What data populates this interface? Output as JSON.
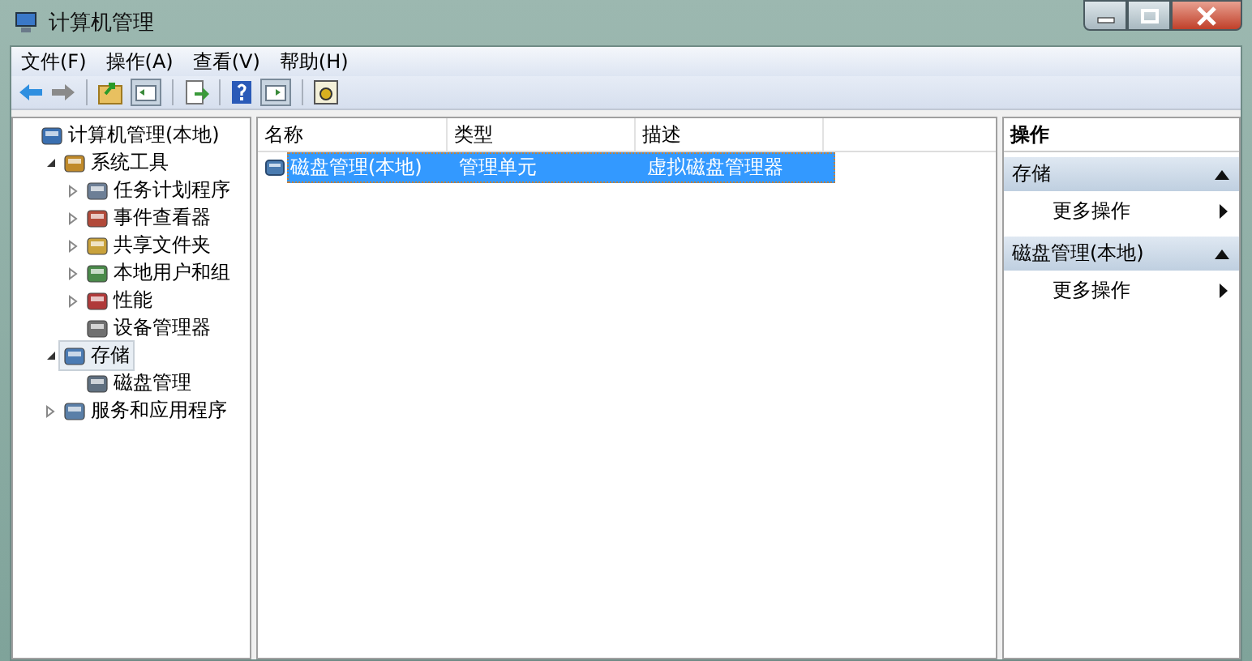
{
  "window": {
    "title": "计算机管理"
  },
  "menu": [
    "文件(F)",
    "操作(A)",
    "查看(V)",
    "帮助(H)"
  ],
  "tree": [
    {
      "label": "计算机管理(本地)",
      "selected": false,
      "children": [
        {
          "label": "系统工具",
          "selected": false,
          "expanded": true,
          "children": [
            {
              "label": "任务计划程序",
              "selected": false,
              "expanded": false
            },
            {
              "label": "事件查看器",
              "selected": false,
              "expanded": false
            },
            {
              "label": "共享文件夹",
              "selected": false,
              "expanded": false
            },
            {
              "label": "本地用户和组",
              "selected": false,
              "expanded": false
            },
            {
              "label": "性能",
              "selected": false,
              "expanded": false
            },
            {
              "label": "设备管理器",
              "selected": false
            }
          ]
        },
        {
          "label": "存储",
          "selected": true,
          "expanded": true,
          "children": [
            {
              "label": "磁盘管理",
              "selected": false
            }
          ]
        },
        {
          "label": "服务和应用程序",
          "selected": false,
          "expanded": false
        }
      ]
    }
  ],
  "table": {
    "columns": [
      "名称",
      "类型",
      "描述"
    ],
    "rows": [
      {
        "cells": [
          "磁盘管理(本地)",
          "管理单元",
          "虚拟磁盘管理器"
        ],
        "selected": true
      }
    ]
  },
  "actions": {
    "title": "操作",
    "sections": [
      {
        "title": "存储",
        "items": [
          "更多操作"
        ]
      },
      {
        "title": "磁盘管理(本地)",
        "items": [
          "更多操作"
        ]
      }
    ]
  }
}
